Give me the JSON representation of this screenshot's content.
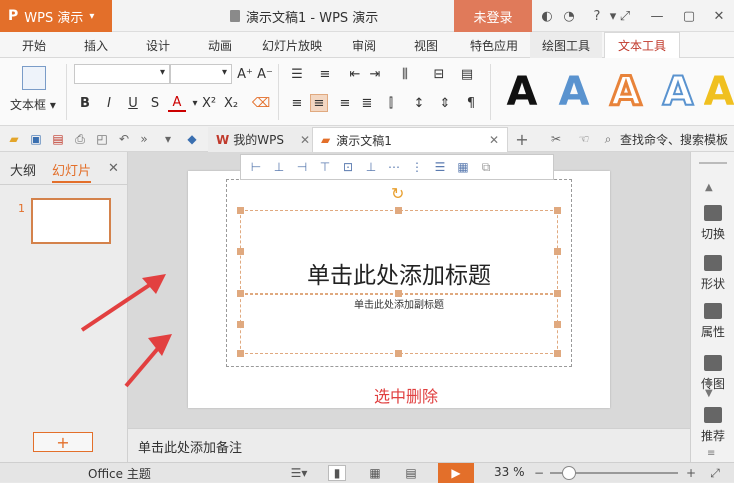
{
  "window": {
    "app_name": "WPS 演示",
    "doc_title": "演示文稿1 - WPS 演示",
    "login_label": "未登录"
  },
  "menu": {
    "items": [
      "开始",
      "插入",
      "设计",
      "动画",
      "幻灯片放映",
      "审阅",
      "视图",
      "特色应用",
      "绘图工具",
      "文本工具"
    ]
  },
  "ribbon": {
    "textbox_label": "文本框",
    "art_letter": "A",
    "colors": {
      "art_black": "#111111",
      "art_blue": "#5a93cf",
      "art_orange": "#e8833a",
      "art_outline": "#5a93cf",
      "accent": "#e36f2a"
    }
  },
  "tabs": {
    "mywps": "我的WPS",
    "doc": "演示文稿1",
    "search": "查找命令、搜索模板"
  },
  "left_panel": {
    "outline_tab": "大纲",
    "slides_tab": "幻灯片",
    "slide_number": "1"
  },
  "slide": {
    "title_placeholder": "单击此处添加标题",
    "subtitle_placeholder": "单击此处添加副标题",
    "annotation": "选中删除"
  },
  "notes": {
    "placeholder": "单击此处添加备注"
  },
  "right_panel": {
    "items": [
      "切换",
      "形状",
      "属性",
      "传图",
      "推荐"
    ]
  },
  "status": {
    "theme": "Office 主题",
    "zoom": "33 %"
  }
}
